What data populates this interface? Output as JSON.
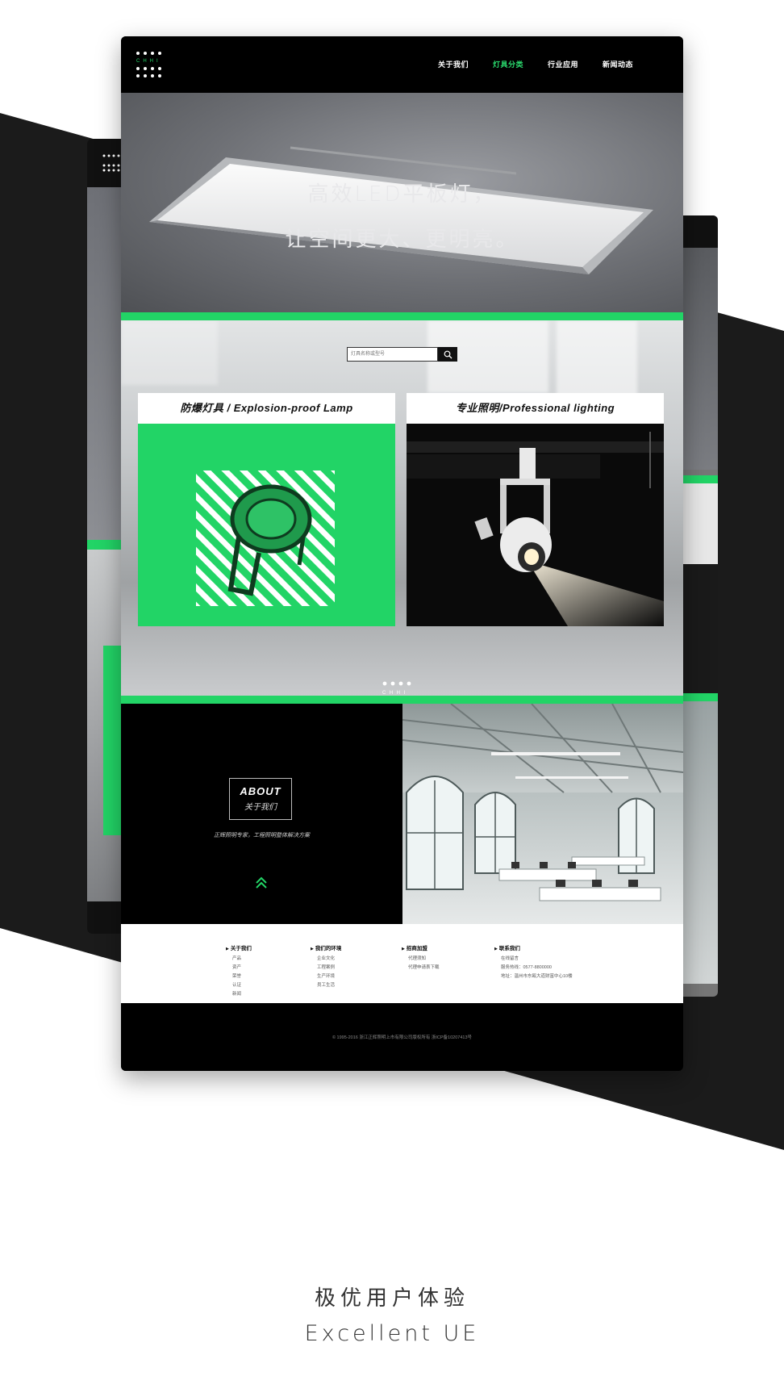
{
  "nav": {
    "items": [
      {
        "label": "关于我们"
      },
      {
        "label": "灯具分类",
        "active": true
      },
      {
        "label": "行业应用"
      },
      {
        "label": "新闻动态"
      }
    ]
  },
  "logo_text": "CHHI",
  "hero": {
    "line1": "高效LED平板灯，",
    "line2": "让空间更大、更明亮。",
    "slide_count": 8,
    "active_slide": 1
  },
  "search": {
    "placeholder": "灯具名称或型号"
  },
  "products": [
    {
      "title": "防爆灯具 / Explosion-proof Lamp"
    },
    {
      "title": "专业照明/Professional lighting"
    }
  ],
  "about": {
    "title_en": "ABOUT",
    "title_cn": "关于我们",
    "slogan": "正辉照明专家，工程照明整体解决方案"
  },
  "footer": {
    "columns": [
      {
        "title": "关于我们",
        "items": [
          "产品",
          "资产",
          "荣誉",
          "认证",
          "新闻"
        ]
      },
      {
        "title": "我们的环境",
        "items": [
          "企业文化",
          "工程案例",
          "生产环境",
          "员工生活"
        ]
      },
      {
        "title": "招商加盟",
        "items": [
          "代理须知",
          "代理申请表下载"
        ]
      },
      {
        "title": "联系我们",
        "items": [
          "在线留言",
          "服务热线：0577-8800000",
          "地址：温州市东瓯大道财富中心10楼"
        ]
      }
    ],
    "copyright": "© 1995-2016 浙江正辉照明上市有限公司版权所有  浙ICP备10207413号"
  },
  "tagline": {
    "cn": "极优用户体验",
    "en": "Excellent UE"
  },
  "colors": {
    "accent": "#22d466",
    "dark": "#111111",
    "background": "#ffffff"
  }
}
